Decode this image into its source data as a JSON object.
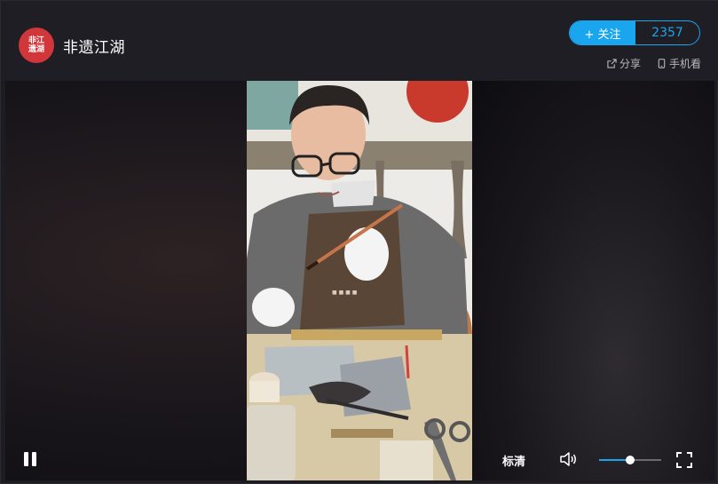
{
  "channel": {
    "name": "非遗江湖",
    "avatar_text_line1": "非江",
    "avatar_text_line2": "遗湖"
  },
  "follow": {
    "button_label": "+ 关注",
    "count": "2357"
  },
  "actions": {
    "share_label": "分享",
    "mobile_label": "手机看"
  },
  "player": {
    "quality_label": "标清",
    "volume_level": 0.5,
    "icons": [
      "pause-icon",
      "volume-icon",
      "fullscreen-icon",
      "share-icon",
      "phone-icon"
    ]
  },
  "colors": {
    "accent": "#1aa6ef",
    "avatar_bg": "#d0363a",
    "header_bg": "#1f1e25"
  }
}
